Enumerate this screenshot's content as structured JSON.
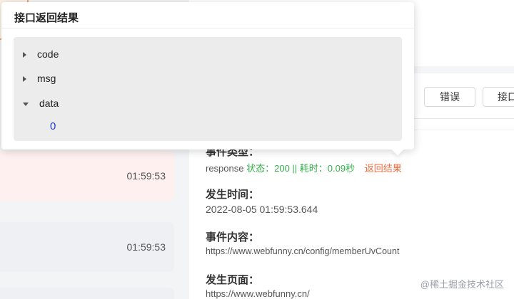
{
  "popover": {
    "title": "接口返回结果",
    "json_tree": [
      {
        "key": "code",
        "expanded": false
      },
      {
        "key": "msg",
        "expanded": false
      },
      {
        "key": "data",
        "expanded": true,
        "value": "0"
      }
    ]
  },
  "tabs": {
    "error_label": "错误",
    "api_label": "接口"
  },
  "event_list": [
    {
      "time": "01:59:53"
    },
    {
      "time": "01:59:53"
    }
  ],
  "detail": {
    "type_label": "事件类型：",
    "type_prefix": "response",
    "type_status": "状态：200 || 耗时：0.09秒",
    "type_link": "返回结果",
    "time_label": "发生时间：",
    "time_value": "2022-08-05 01:59:53.644",
    "content_label": "事件内容：",
    "content_value": "https://www.webfunny.cn/config/memberUvCount",
    "page_label": "发生页面：",
    "page_value": "https://www.webfunny.cn/"
  },
  "watermark": "@稀土掘金技术社区",
  "colors": {
    "status_green": "#35b04a",
    "link_orange": "#f06a3c",
    "json_value_blue": "#1f3cd6",
    "error_card_bg": "#fdf0ef"
  }
}
